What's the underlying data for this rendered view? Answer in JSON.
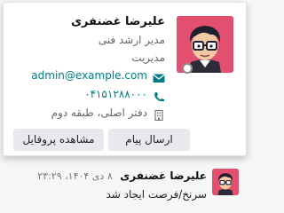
{
  "profile_card": {
    "name": "علیرضا غضنفری",
    "job_title": "مدیر ارشد فنی",
    "role": "مدیریت",
    "email": "admin@example.com",
    "phone": "۰۴۱۵۱۲۸۸۰۰۰",
    "location": "دفتر اصلی، طبقه دوم",
    "status": "offline",
    "send_message_label": "ارسال پیام",
    "view_profile_label": "مشاهده پروفایل",
    "avatar_color": "#e34f6f",
    "link_color": "#017e84"
  },
  "message": {
    "author": "علیرضا غضنفری",
    "date": "۸ دی ۱۴۰۴، ۲۳:۲۹",
    "body": "سرنخ/فرصت ایجاد شد"
  }
}
